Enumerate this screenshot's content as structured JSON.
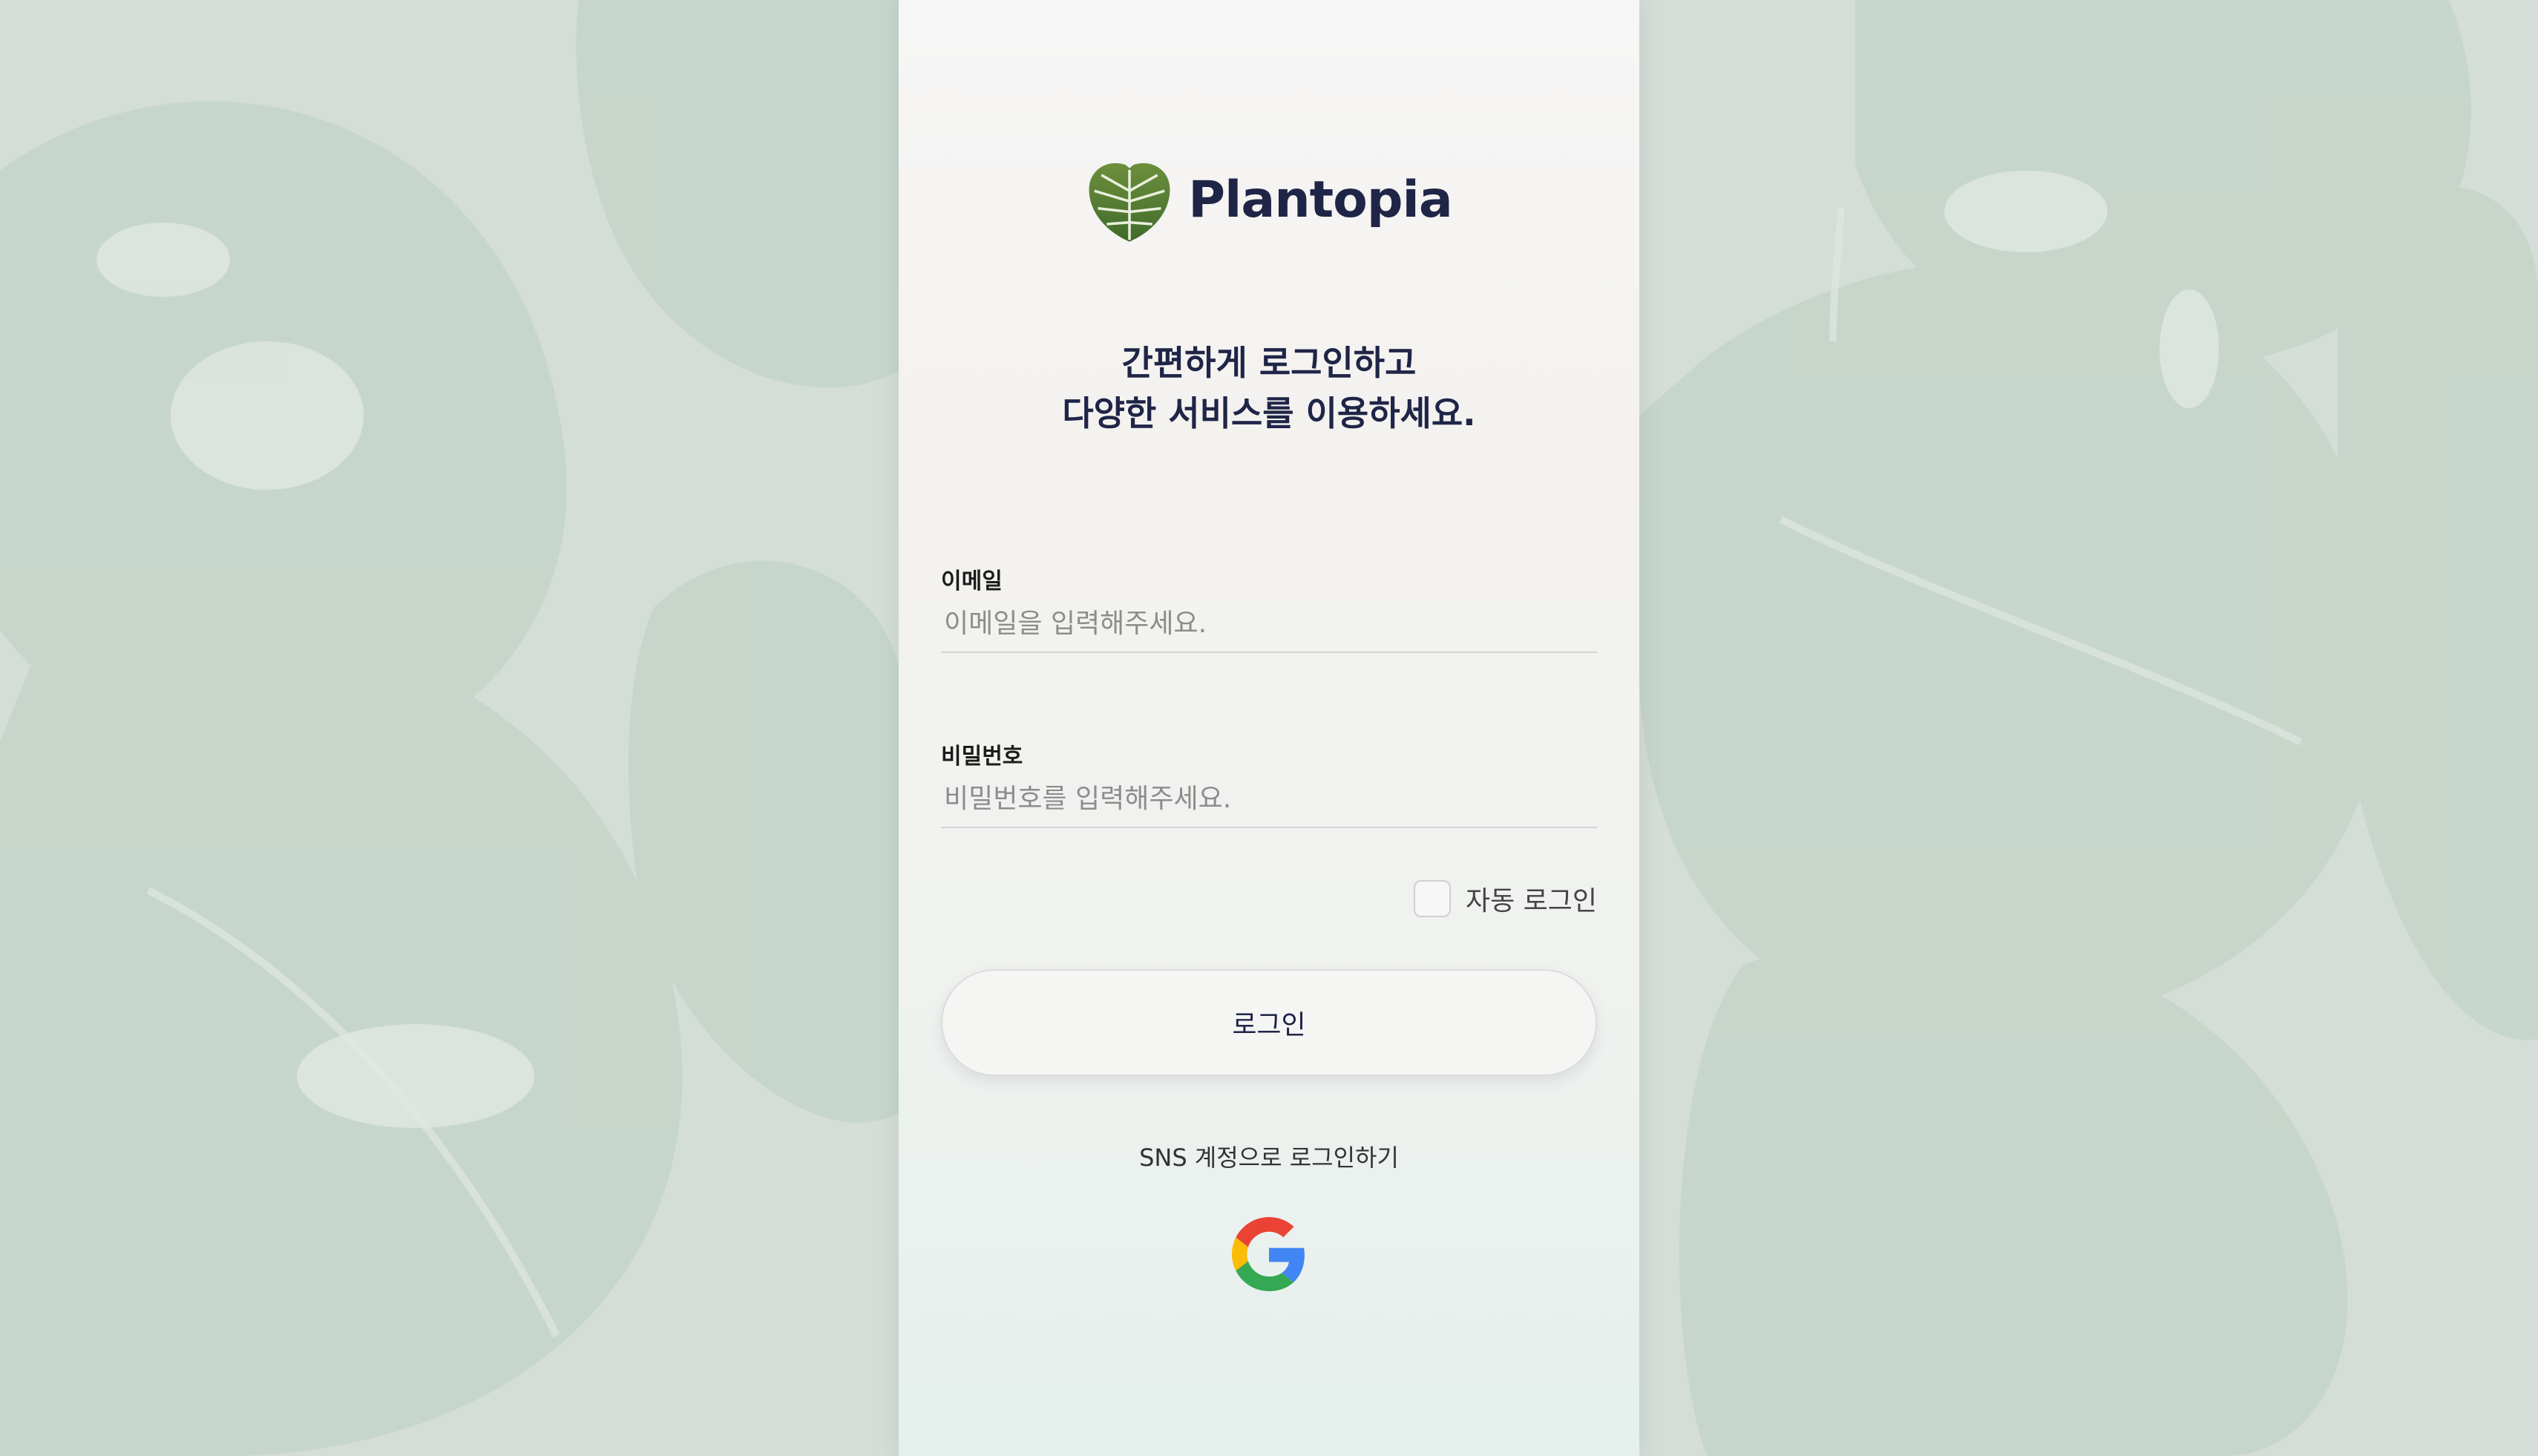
{
  "brand": {
    "name": "Plantopia"
  },
  "headline": {
    "line1": "간편하게 로그인하고",
    "line2": "다양한 서비스를 이용하세요."
  },
  "form": {
    "email": {
      "label": "이메일",
      "placeholder": "이메일을 입력해주세요.",
      "value": ""
    },
    "password": {
      "label": "비밀번호",
      "placeholder": "비밀번호를 입력해주세요.",
      "value": ""
    },
    "auto_login": {
      "label": "자동 로그인",
      "checked": false
    },
    "login_button": "로그인"
  },
  "sns": {
    "prompt": "SNS 계정으로 로그인하기",
    "providers": [
      "google-icon"
    ]
  },
  "colors": {
    "brand_text": "#1f2547",
    "background": "#d3ddd8",
    "panel": "#f6f6f6"
  }
}
